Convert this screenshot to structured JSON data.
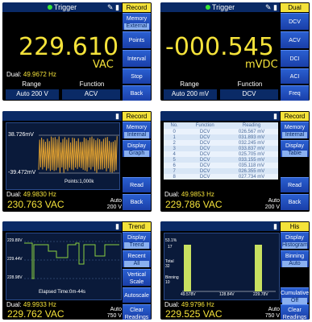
{
  "panels": [
    {
      "trigger": "Trigger",
      "tag": "Record",
      "buttons": [
        {
          "label": "Memory",
          "sub": "External"
        },
        {
          "label": "Points"
        },
        {
          "label": "Interval"
        },
        {
          "label": "Stop"
        },
        {
          "label": "Back"
        }
      ],
      "value": "229.610",
      "unit": "VAC",
      "dual_label": "Dual:",
      "dual_value": "49.9672  Hz",
      "range_label": "Range",
      "function_label": "Function",
      "range_value": "Auto  200 V",
      "function_value": "ACV"
    },
    {
      "trigger": "Trigger",
      "tag": "Dual",
      "buttons": [
        {
          "label": "DCV"
        },
        {
          "label": "ACV"
        },
        {
          "label": "DCI"
        },
        {
          "label": "ACI"
        },
        {
          "label": "Freq"
        }
      ],
      "value": "-000.545",
      "unit": "mVDC",
      "range_label": "Range",
      "function_label": "Function",
      "range_value": "Auto  200 mV",
      "function_value": "DCV"
    },
    {
      "tag": "Record",
      "buttons": [
        {
          "label": "Memory",
          "sub": "Internal"
        },
        {
          "label": "Display",
          "sub": "Graph"
        },
        {
          "label": "Read"
        },
        {
          "label": "Back"
        }
      ],
      "max": "38.726mV",
      "min": "-39.472mV",
      "points": "Points:1,000k",
      "dual_label": "Dual:",
      "dual_value": "49.9830  Hz",
      "value": "230.763 VAC",
      "range": "Auto",
      "range2": "200 V"
    },
    {
      "tag": "Record",
      "buttons": [
        {
          "label": "Memory",
          "sub": "Internal"
        },
        {
          "label": "Display",
          "sub": "Table"
        },
        {
          "label": "Read"
        },
        {
          "label": "Back"
        }
      ],
      "headers": [
        "No.",
        "Function",
        "Reading"
      ],
      "rows": [
        [
          "0",
          "DCV",
          "026.567  mV"
        ],
        [
          "1",
          "DCV",
          "031.893  mV"
        ],
        [
          "2",
          "DCV",
          "032.245  mV"
        ],
        [
          "3",
          "DCV",
          "033.837  mV"
        ],
        [
          "4",
          "DCV",
          "025.705  mV"
        ],
        [
          "5",
          "DCV",
          "033.155  mV"
        ],
        [
          "6",
          "DCV",
          "035.118  mV"
        ],
        [
          "7",
          "DCV",
          "026.355  mV"
        ],
        [
          "8",
          "DCV",
          "027.734  mV"
        ]
      ],
      "dual_label": "Dual:",
      "dual_value": "49.9853  Hz",
      "value": "229.786 VAC",
      "range": "Auto",
      "range2": "200 V"
    },
    {
      "tag": "Trend",
      "buttons": [
        {
          "label": "Display",
          "sub": "Trend"
        },
        {
          "label": "Recent",
          "sub": "All"
        },
        {
          "label": "Vertical Scale"
        },
        {
          "label": "Autoscale"
        }
      ],
      "y_top": "229.89V",
      "y_mid": "229.44V",
      "y_bot": "228.98V",
      "elapsed": "Elapsed Time:0m-44s",
      "dual_label": "Dual:",
      "dual_value": "49.9933  Hz",
      "value": "229.762 VAC",
      "range": "Auto",
      "range2": "750 V",
      "clear": "Clear Readings"
    },
    {
      "tag": "His",
      "buttons": [
        {
          "label": "Display",
          "sub": "Histogram"
        },
        {
          "label": "Binning",
          "sub": "Auto"
        },
        {
          "label": "Cumulative",
          "sub": "Off"
        }
      ],
      "pct": "53.1%",
      "count": "17",
      "total": "Total",
      "total_v": "32",
      "binning": "Binning",
      "binning_v": "10",
      "x1": "49.578V",
      "x2": "128.84V",
      "x3": "229.78V",
      "dual_label": "Dual:",
      "dual_value": "49.9796  Hz",
      "value": "229.525 VAC",
      "range": "Auto",
      "range2": "750 V",
      "clear": "Clear Readings"
    }
  ]
}
